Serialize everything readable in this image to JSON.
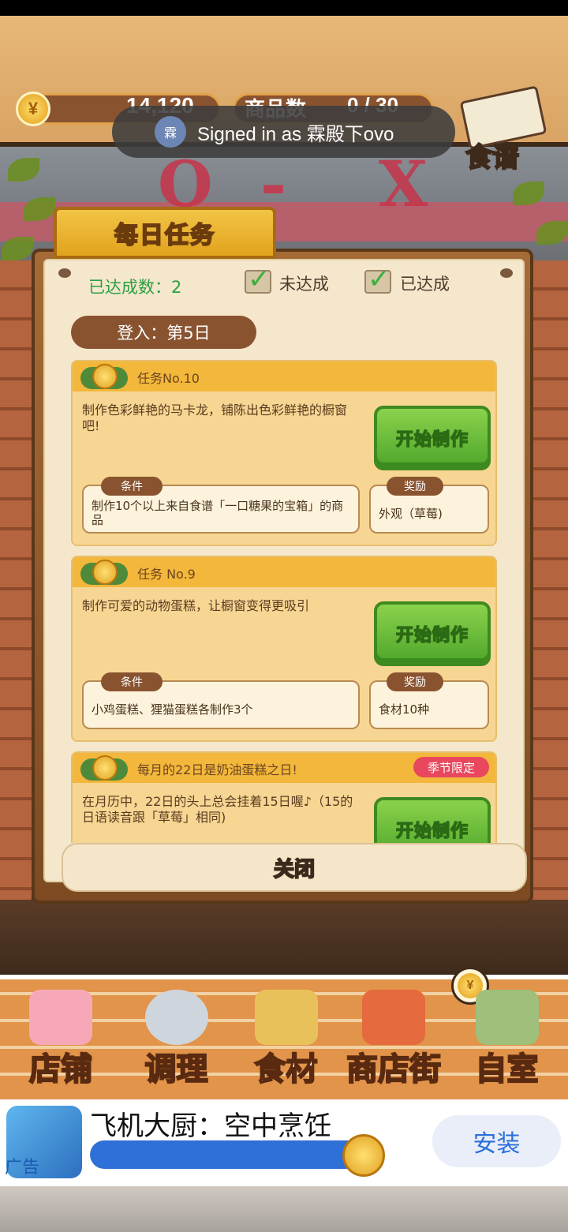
{
  "hud": {
    "coin_symbol": "¥",
    "coins": "14,120",
    "products_label": "商品数",
    "products_value": "0 / 30"
  },
  "toast": {
    "avatar_text": "霖",
    "message": "Signed in as 霖殿下ovo"
  },
  "recipe_button": {
    "label": "食谱"
  },
  "modal": {
    "title": "每日任务",
    "achieved_count": "已达成数：2",
    "legend_unachieved": "未达成",
    "legend_achieved": "已达成",
    "login_day": "登入：第5日",
    "close_label": "关闭",
    "condition_tab": "条件",
    "reward_tab": "奖励",
    "start_button": "开始制作",
    "tasks": [
      {
        "title": "任务No.10",
        "description": "制作色彩鲜艳的马卡龙，铺陈出色彩鲜艳的橱窗吧!",
        "condition": "制作10个以上来自食谱「一口糖果的宝箱」的商品",
        "reward": "外观（草莓)",
        "tag": ""
      },
      {
        "title": "任务 No.9",
        "description": "制作可爱的动物蛋糕，让橱窗变得更吸引",
        "condition": "小鸡蛋糕、狸猫蛋糕各制作3个",
        "reward": "食材10种",
        "tag": ""
      },
      {
        "title": "每月的22日是奶油蛋糕之日!",
        "description": "在月历中，22日的头上总会挂着15日喔♪（15的日语读音跟「草莓」相同)",
        "condition": "",
        "reward": "",
        "tag": "季节限定"
      }
    ]
  },
  "nav": {
    "coin_symbol": "¥",
    "items": [
      {
        "label": "店铺",
        "icon": "cake-icon"
      },
      {
        "label": "调理",
        "icon": "mixing-bowl-icon"
      },
      {
        "label": "食材",
        "icon": "flour-sack-icon"
      },
      {
        "label": "商店街",
        "icon": "storefront-icon"
      },
      {
        "label": "自室",
        "icon": "staff-only-door-icon"
      }
    ]
  },
  "ad": {
    "title": "飞机大厨：空中烹饪",
    "tag": "广告",
    "install_label": "安装",
    "progress": 0.95
  },
  "colors": {
    "accent_gold": "#f3b73b",
    "start_green": "#4fa62b",
    "season_red": "#e8475d",
    "achieved_green": "#2aa043"
  }
}
